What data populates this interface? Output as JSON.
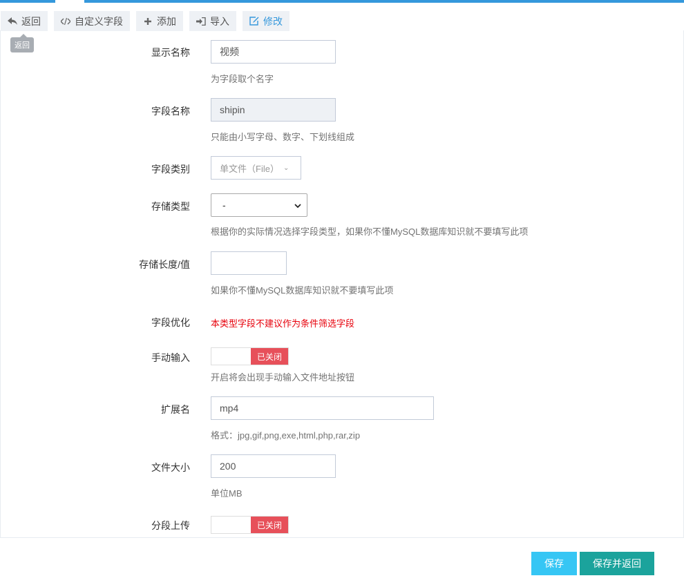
{
  "toolbar": {
    "back_label": "返回",
    "custom_field_label": "自定义字段",
    "add_label": "添加",
    "import_label": "导入",
    "edit_label": "修改",
    "tooltip": "返回"
  },
  "form": {
    "display_name": {
      "label": "显示名称",
      "value": "视频",
      "help": "为字段取个名字"
    },
    "field_name": {
      "label": "字段名称",
      "value": "shipin",
      "help": "只能由小写字母、数字、下划线组成"
    },
    "field_type": {
      "label": "字段类别",
      "value": "单文件（File）"
    },
    "storage_type": {
      "label": "存储类型",
      "value": "-",
      "help": "根据你的实际情况选择字段类型，如果你不懂MySQL数据库知识就不要填写此项"
    },
    "storage_length": {
      "label": "存储长度/值",
      "value": "",
      "help": "如果你不懂MySQL数据库知识就不要填写此项"
    },
    "field_optimize": {
      "label": "字段优化",
      "help": "本类型字段不建议作为条件筛选字段"
    },
    "manual_input": {
      "label": "手动输入",
      "switch_label": "已关闭",
      "help": "开启将会出现手动输入文件地址按钮"
    },
    "extension": {
      "label": "扩展名",
      "value": "mp4",
      "help": "格式：jpg,gif,png,exe,html,php,rar,zip"
    },
    "file_size": {
      "label": "文件大小",
      "value": "200",
      "help": "单位MB"
    },
    "chunk_upload": {
      "label": "分段上传",
      "switch_label": "已关闭"
    }
  },
  "actions": {
    "save_label": "保存",
    "save_back_label": "保存并返回"
  },
  "colors": {
    "accent_blue": "#3598dc",
    "switch_off_red": "#e7505a",
    "save_button": "#36c6f4",
    "save_back_button": "#1ba39c",
    "warning_text": "#e7000b"
  }
}
